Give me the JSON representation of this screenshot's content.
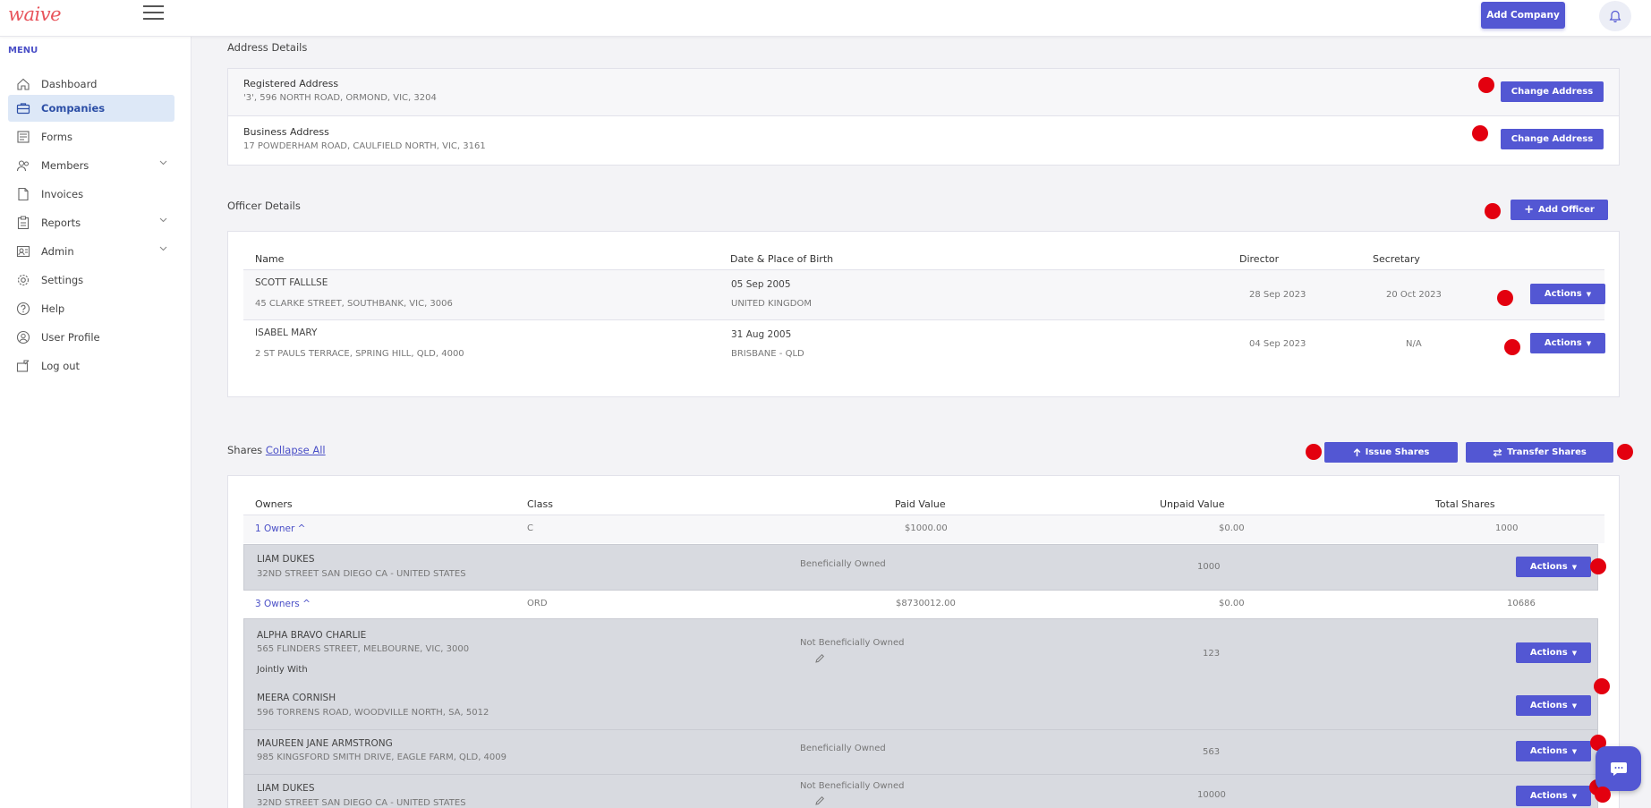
{
  "brand": {
    "logo": "waive"
  },
  "header": {
    "add_company_label": "Add Company"
  },
  "sidebar": {
    "menu_title": "MENU",
    "items": [
      {
        "label": "Dashboard",
        "icon": "home-icon"
      },
      {
        "label": "Companies",
        "icon": "briefcase-icon",
        "active": true
      },
      {
        "label": "Forms",
        "icon": "forms-icon"
      },
      {
        "label": "Members",
        "icon": "members-icon",
        "expandable": true
      },
      {
        "label": "Invoices",
        "icon": "document-icon"
      },
      {
        "label": "Reports",
        "icon": "clipboard-icon",
        "expandable": true
      },
      {
        "label": "Admin",
        "icon": "admin-icon",
        "expandable": true
      },
      {
        "label": "Settings",
        "icon": "gear-icon"
      },
      {
        "label": "Help",
        "icon": "help-icon"
      },
      {
        "label": "User Profile",
        "icon": "user-icon"
      },
      {
        "label": "Log out",
        "icon": "logout-icon"
      }
    ]
  },
  "address": {
    "title": "Address Details",
    "registered_label": "Registered Address",
    "registered_value": "'3', 596 NORTH ROAD, ORMOND, VIC, 3204",
    "business_label": "Business Address",
    "business_value": "17 POWDERHAM ROAD, CAULFIELD NORTH, VIC, 3161",
    "change_label": "Change Address"
  },
  "officers": {
    "title": "Officer Details",
    "add_label": "Add Officer",
    "columns": {
      "name": "Name",
      "dob": "Date & Place of Birth",
      "director": "Director",
      "secretary": "Secretary"
    },
    "rows": [
      {
        "name": "SCOTT FALLLSE",
        "address": "45 CLARKE STREET, SOUTHBANK, VIC, 3006",
        "dob": "05 Sep 2005",
        "place": "UNITED KINGDOM",
        "director": "28 Sep 2023",
        "secretary": "20 Oct 2023"
      },
      {
        "name": "ISABEL MARY",
        "address": "2 ST PAULS TERRACE, SPRING HILL, QLD, 4000",
        "dob": "31 Aug 2005",
        "place": "BRISBANE - QLD",
        "director": "04 Sep 2023",
        "secretary": "N/A"
      }
    ],
    "actions_label": "Actions"
  },
  "shares": {
    "title": "Shares",
    "collapse_label": "Collapse All",
    "issue_label": "Issue Shares",
    "transfer_label": "Transfer Shares",
    "columns": {
      "owners": "Owners",
      "class": "Class",
      "paid": "Paid Value",
      "unpaid": "Unpaid Value",
      "total": "Total Shares"
    },
    "groups": [
      {
        "owners": "1 Owner ^",
        "class": "C",
        "paid": "$1000.00",
        "unpaid": "$0.00",
        "total": "1000"
      },
      {
        "owners": "3 Owners ^",
        "class": "ORD",
        "paid": "$8730012.00",
        "unpaid": "$0.00",
        "total": "10686"
      }
    ],
    "holders": [
      {
        "name": "LIAM DUKES",
        "address": "32ND STREET SAN DIEGO CA - UNITED STATES",
        "status": "Beneficially Owned",
        "shares": "1000"
      },
      {
        "name": "ALPHA BRAVO CHARLIE",
        "address": "565 FLINDERS STREET, MELBOURNE, VIC, 3000",
        "note": "Jointly With",
        "status": "Not Beneficially Owned",
        "shares": "123"
      },
      {
        "name": "MEERA CORNISH",
        "address": "596 TORRENS ROAD, WOODVILLE NORTH, SA, 5012"
      },
      {
        "name": "MAUREEN JANE ARMSTRONG",
        "address": "985 KINGSFORD SMITH DRIVE, EAGLE FARM, QLD, 4009",
        "status": "Beneficially Owned",
        "shares": "563"
      },
      {
        "name": "LIAM DUKES",
        "address": "32ND STREET SAN DIEGO CA - UNITED STATES",
        "status": "Not Beneficially Owned",
        "shares": "10000"
      }
    ]
  },
  "colors": {
    "primary": "#5357d3",
    "marker": "#e3000f",
    "brand": "#e8545b"
  }
}
